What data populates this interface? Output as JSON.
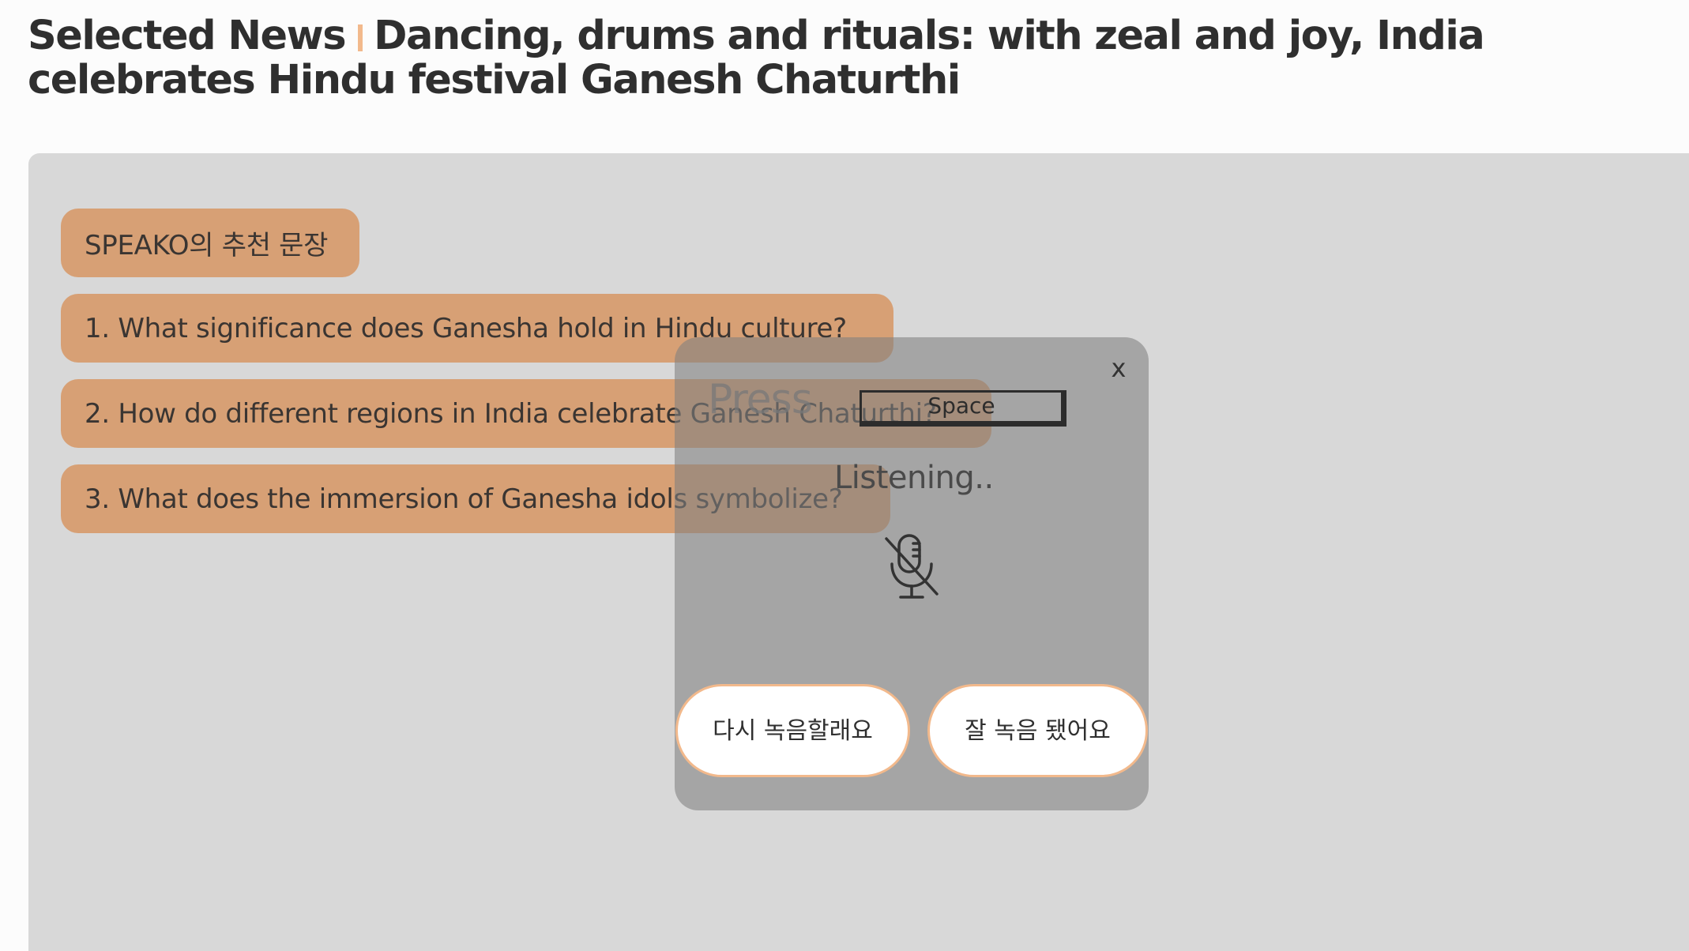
{
  "header": {
    "section_label": "Selected News",
    "title": "Dancing, drums and rituals: with zeal and joy, India celebrates Hindu festival Ganesh Chaturthi"
  },
  "recommendations": {
    "title": "SPEAKO의 추천 문장",
    "items": [
      "1. What significance does Ganesha hold in Hindu culture?",
      "2. How do different regions in India celebrate Ganesh Chaturthi?",
      "3. What does the immersion of Ganesha idols symbolize?"
    ]
  },
  "recording_modal": {
    "close_label": "x",
    "press_label": "Press",
    "key_label": "Space",
    "status": "Listening..",
    "mic_icon": "mic-off-icon",
    "retry_label": "다시 녹음할래요",
    "done_label": "잘 녹음 됐어요"
  },
  "colors": {
    "accent": "#f2b98c",
    "chip": "#d7a075",
    "panel": "#d8d8d8",
    "overlay": "#808080"
  }
}
